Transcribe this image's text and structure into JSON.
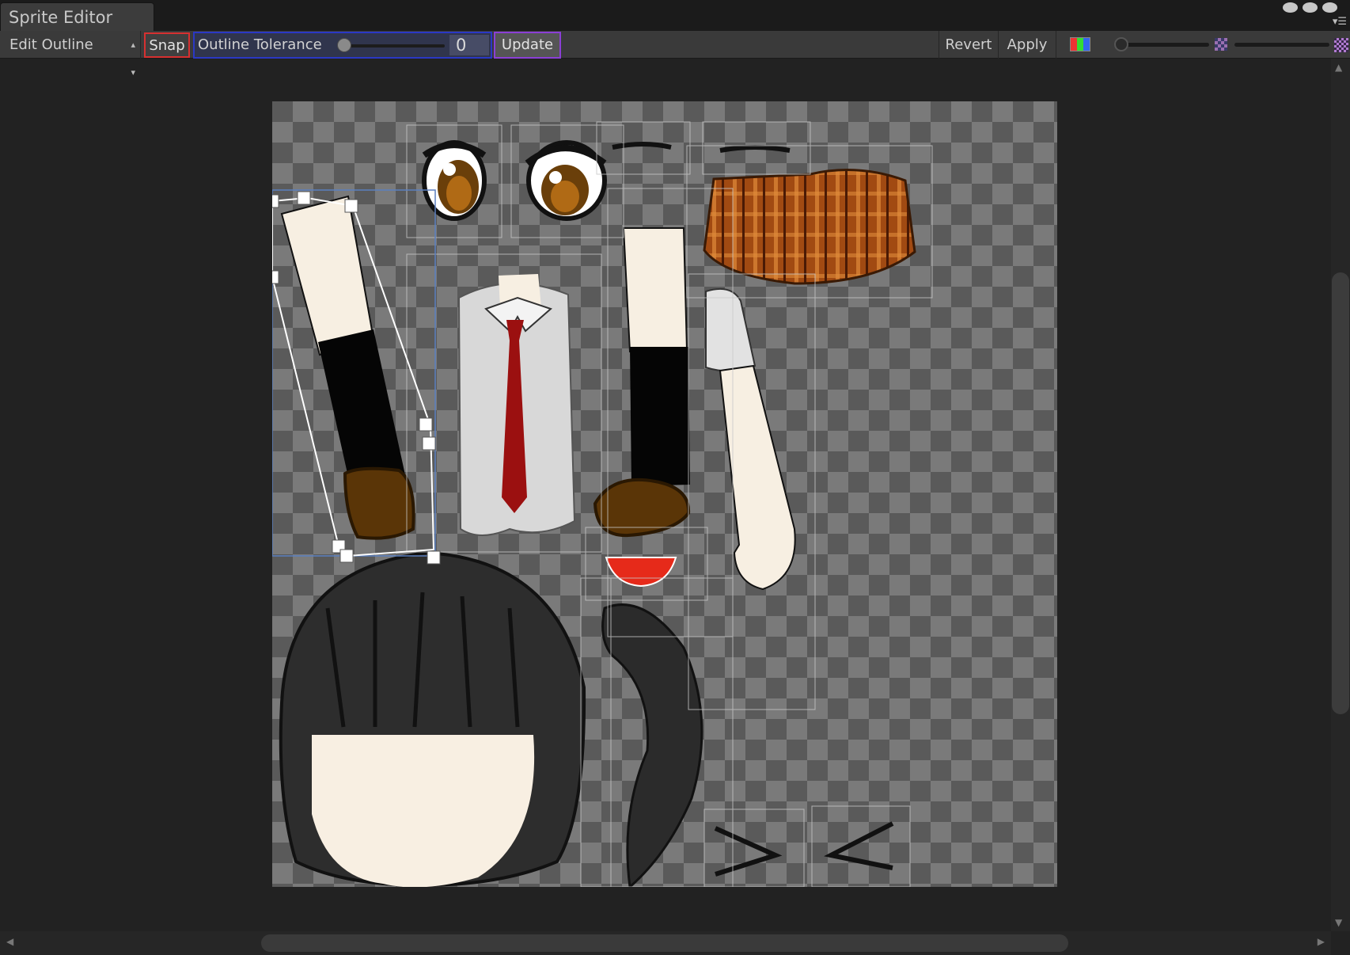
{
  "window": {
    "tab_title": "Sprite Editor"
  },
  "toolbar": {
    "mode": "Edit Outline",
    "snap_label": "Snap",
    "tolerance_label": "Outline Tolerance",
    "tolerance_value": "0",
    "update_label": "Update",
    "revert_label": "Revert",
    "apply_label": "Apply"
  },
  "colors": {
    "snap_border": "#d63030",
    "tolerance_border": "#2a38c4",
    "update_border": "#8b3fd6",
    "checker_light": "#7a7a7a",
    "checker_dark": "#5a5a5a"
  },
  "icons": [
    "color-channel-icon",
    "alpha-icon",
    "mip-icon",
    "window-control-icon"
  ],
  "sprites": [
    "eye-left",
    "eye-right",
    "eyebrow-left",
    "eyebrow-right",
    "skirt",
    "leg-left",
    "shirt",
    "leg-right",
    "arm",
    "mouth",
    "hair-front",
    "ponytail",
    "face-greater-than",
    "face-less-than"
  ]
}
